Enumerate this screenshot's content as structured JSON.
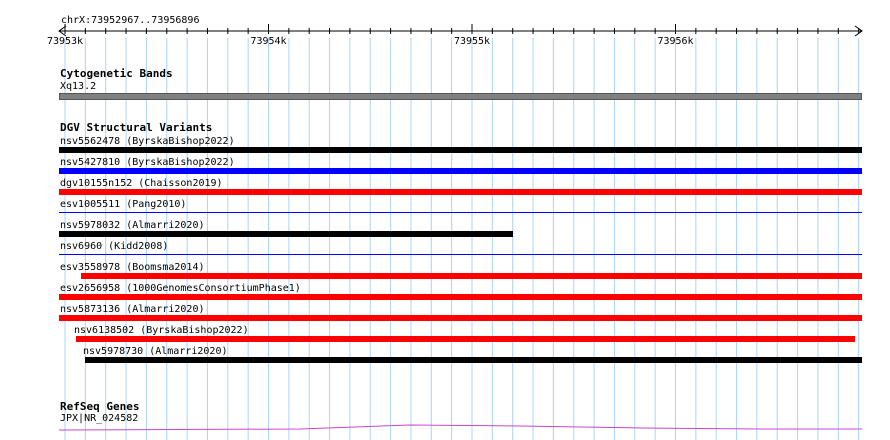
{
  "ruler": {
    "range_label": "chrX:73952967..73956896",
    "ticks": [
      "73953k",
      "73954k",
      "73955k",
      "73956k"
    ]
  },
  "cytoband": {
    "title": "Cytogenetic Bands",
    "band_label": "Xq13.2",
    "band_color": "#808080"
  },
  "dgv": {
    "title": "DGV Structural Variants",
    "features": [
      {
        "label": "nsv5562478 (ByrskaBishop2022)",
        "color": "#000000",
        "style": "thick"
      },
      {
        "label": "nsv5427810 (ByrskaBishop2022)",
        "color": "#0000ff",
        "style": "thick"
      },
      {
        "label": "dgv10155n152 (Chaisson2019)",
        "color": "#ff0000",
        "style": "thick"
      },
      {
        "label": "esv1005511 (Pang2010)",
        "color": "#0000ff",
        "style": "thin"
      },
      {
        "label": "nsv5978032 (Almarri2020)",
        "color": "#000000",
        "style": "thick"
      },
      {
        "label": "nsv6960 (Kidd2008)",
        "color": "#0000ff",
        "style": "thin"
      },
      {
        "label": "esv3558978 (Boomsma2014)",
        "color": "#ff0000",
        "style": "thick"
      },
      {
        "label": "esv2656958 (1000GenomesConsortiumPhase1)",
        "color": "#ff0000",
        "style": "thick"
      },
      {
        "label": "nsv5873136 (Almarri2020)",
        "color": "#ff0000",
        "style": "thick"
      },
      {
        "label": "nsv6138502 (ByrskaBishop2022)",
        "color": "#ff0000",
        "style": "thick"
      },
      {
        "label": "nsv5978730 (Almarri2020)",
        "color": "#000000",
        "style": "thick"
      }
    ]
  },
  "refseq": {
    "title": "RefSeq Genes",
    "gene_label": "JPX|NR_024582",
    "gene_color": "#cc44cc"
  },
  "colors": {
    "grid": "#aad4f5",
    "ruler": "#000000"
  }
}
